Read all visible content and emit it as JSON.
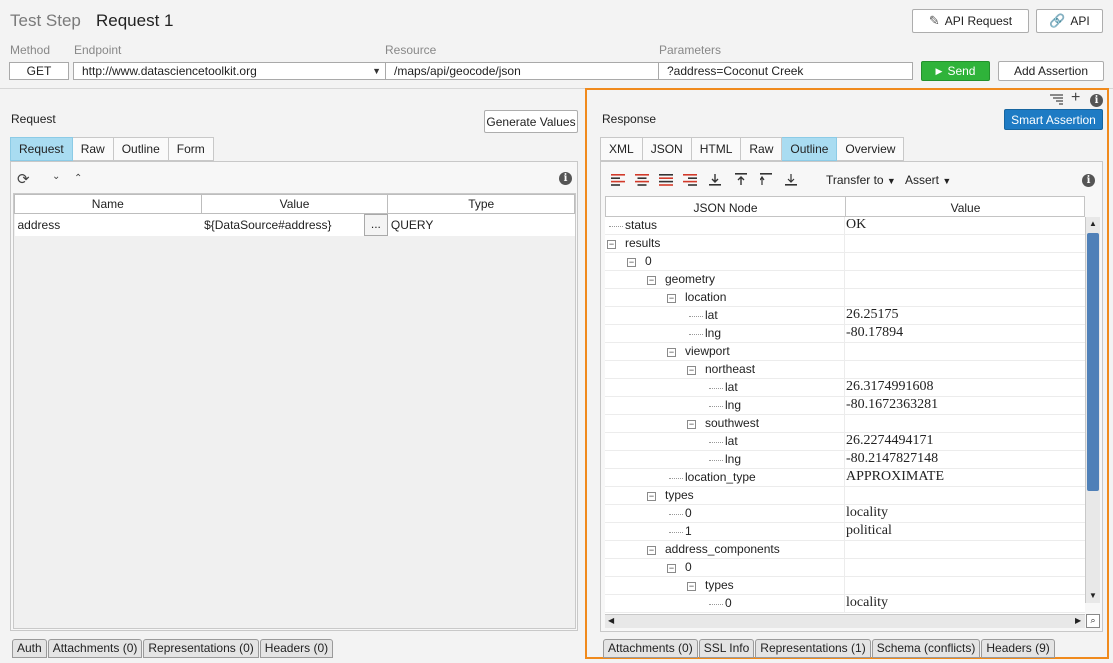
{
  "header": {
    "prefix": "Test Step",
    "title": "Request 1",
    "api_request_label": "API Request",
    "api_label": "API"
  },
  "endpoint_bar": {
    "method_label": "Method",
    "method_value": "GET",
    "endpoint_label": "Endpoint",
    "endpoint_value": "http://www.datasciencetoolkit.org",
    "resource_label": "Resource",
    "resource_value": "/maps/api/geocode/json",
    "parameters_label": "Parameters",
    "parameters_value": "?address=Coconut Creek",
    "send_label": "Send",
    "add_assertion_label": "Add Assertion"
  },
  "request": {
    "title": "Request",
    "generate_values_label": "Generate Values",
    "tabs": [
      "Request",
      "Raw",
      "Outline",
      "Form"
    ],
    "active_tab": "Request",
    "columns": [
      "Name",
      "Value",
      "Type"
    ],
    "rows": [
      {
        "name": "address",
        "value": "${DataSource#address}",
        "type": "QUERY",
        "browse": "..."
      }
    ],
    "bottom_tabs": [
      "Auth",
      "Attachments (0)",
      "Representations (0)",
      "Headers (0)"
    ]
  },
  "response": {
    "title": "Response",
    "smart_assertion_label": "Smart Assertion",
    "tabs": [
      "XML",
      "JSON",
      "HTML",
      "Raw",
      "Outline",
      "Overview"
    ],
    "active_tab": "Outline",
    "transfer_to_label": "Transfer to",
    "assert_label": "Assert",
    "columns": [
      "JSON Node",
      "Value"
    ],
    "nodes": [
      {
        "name": "status",
        "value": "OK",
        "depth": 0,
        "expandable": false
      },
      {
        "name": "results",
        "value": "",
        "depth": 0,
        "expandable": true
      },
      {
        "name": "0",
        "value": "",
        "depth": 1,
        "expandable": true
      },
      {
        "name": "geometry",
        "value": "",
        "depth": 2,
        "expandable": true
      },
      {
        "name": "location",
        "value": "",
        "depth": 3,
        "expandable": true
      },
      {
        "name": "lat",
        "value": "26.25175",
        "depth": 4,
        "expandable": false
      },
      {
        "name": "lng",
        "value": "-80.17894",
        "depth": 4,
        "expandable": false
      },
      {
        "name": "viewport",
        "value": "",
        "depth": 3,
        "expandable": true
      },
      {
        "name": "northeast",
        "value": "",
        "depth": 4,
        "expandable": true
      },
      {
        "name": "lat",
        "value": "26.3174991608",
        "depth": 5,
        "expandable": false
      },
      {
        "name": "lng",
        "value": "-80.1672363281",
        "depth": 5,
        "expandable": false
      },
      {
        "name": "southwest",
        "value": "",
        "depth": 4,
        "expandable": true
      },
      {
        "name": "lat",
        "value": "26.2274494171",
        "depth": 5,
        "expandable": false
      },
      {
        "name": "lng",
        "value": "-80.2147827148",
        "depth": 5,
        "expandable": false
      },
      {
        "name": "location_type",
        "value": "APPROXIMATE",
        "depth": 3,
        "expandable": false
      },
      {
        "name": "types",
        "value": "",
        "depth": 2,
        "expandable": true
      },
      {
        "name": "0",
        "value": "locality",
        "depth": 3,
        "expandable": false
      },
      {
        "name": "1",
        "value": "political",
        "depth": 3,
        "expandable": false
      },
      {
        "name": "address_components",
        "value": "",
        "depth": 2,
        "expandable": true
      },
      {
        "name": "0",
        "value": "",
        "depth": 3,
        "expandable": true
      },
      {
        "name": "types",
        "value": "",
        "depth": 4,
        "expandable": true
      },
      {
        "name": "0",
        "value": "locality",
        "depth": 5,
        "expandable": false
      }
    ],
    "bottom_tabs": [
      "Attachments (0)",
      "SSL Info",
      "Representations (1)",
      "Schema (conflicts)",
      "Headers (9)"
    ]
  },
  "colors": {
    "accent_tab": "#a9dcf1",
    "send_button": "#2fb33a",
    "smart_assertion": "#1e7bc4",
    "highlight_border": "#f08a1c",
    "toolbar_red": "#d23a2a"
  }
}
